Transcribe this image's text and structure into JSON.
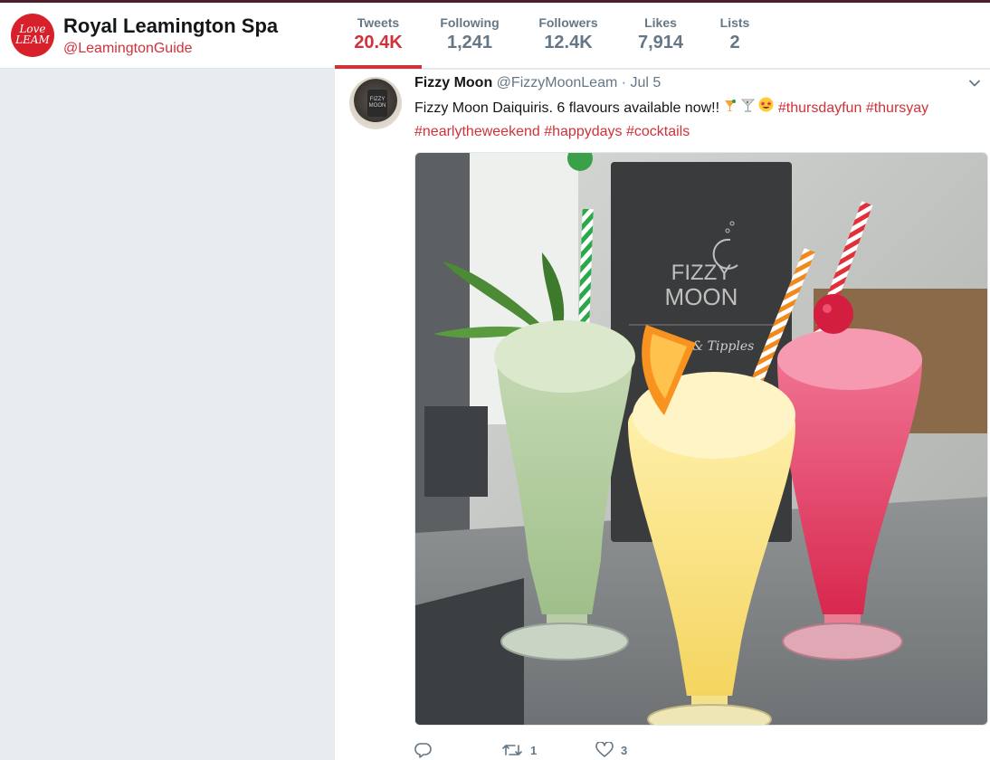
{
  "profile": {
    "avatar_text_top": "Love",
    "avatar_text_bottom": "LEAM",
    "name": "Royal Leamington Spa",
    "handle": "@LeamingtonGuide",
    "accent_color": "#d0323a"
  },
  "nav": [
    {
      "label": "Tweets",
      "value": "20.4K",
      "active": true
    },
    {
      "label": "Following",
      "value": "1,241",
      "active": false
    },
    {
      "label": "Followers",
      "value": "12.4K",
      "active": false
    },
    {
      "label": "Likes",
      "value": "7,914",
      "active": false
    },
    {
      "label": "Lists",
      "value": "2",
      "active": false
    }
  ],
  "tweet": {
    "author": "Fizzy Moon",
    "handle": "@FizzyMoonLeam",
    "separator": "·",
    "date": "Jul 5",
    "avatar_sign_line1": "FIZZY",
    "avatar_sign_line2": "MOON",
    "text_lead": "Fizzy Moon Daiquiris. 6 flavours available now!!",
    "emojis": [
      "tropical-drink-emoji",
      "cocktail-emoji",
      "star-struck-emoji"
    ],
    "hashtags": [
      "#thursdayfun",
      "#thursyay",
      "#nearlytheweekend",
      "#happydays",
      "#cocktails"
    ],
    "media": {
      "sign_line1": "FIZZY",
      "sign_line2": "MOON",
      "sign_script": "& Tipples"
    },
    "actions": {
      "reply_icon": "reply-icon",
      "retweet_icon": "retweet-icon",
      "retweet_count": "1",
      "like_icon": "heart-icon",
      "like_count": "3"
    }
  }
}
